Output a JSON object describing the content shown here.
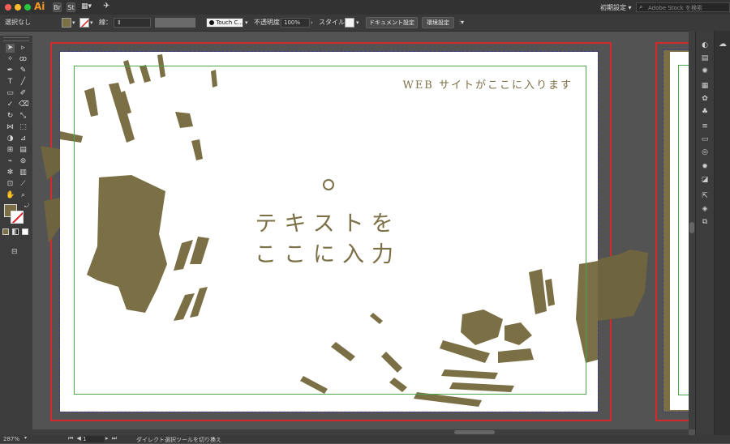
{
  "app": {
    "logo": "Ai",
    "bridge_label": "Br",
    "stock_label": "St",
    "workspace": "初期設定",
    "search_placeholder": "Adobe Stock を検索"
  },
  "control_bar": {
    "selection": "選択なし",
    "stroke_label": "線：",
    "brush": "Touch C...",
    "opacity_label": "不透明度：",
    "opacity_value": "100%",
    "style_label": "スタイル：",
    "document_setup": "ドキュメント設定",
    "preferences": "環境設定"
  },
  "artboard": {
    "web_text": "WEB サイトがここに入ります",
    "main_line1": "テキストを",
    "main_line2": "ここに入力"
  },
  "status_bar": {
    "zoom": "287%",
    "artboard_number": "1",
    "tool_hint": "ダイレクト選択ツールを切り換え"
  },
  "colors": {
    "accent_olive": "#7b6f45",
    "guide_red": "#d42a2a",
    "guide_green": "#4ca64c"
  }
}
